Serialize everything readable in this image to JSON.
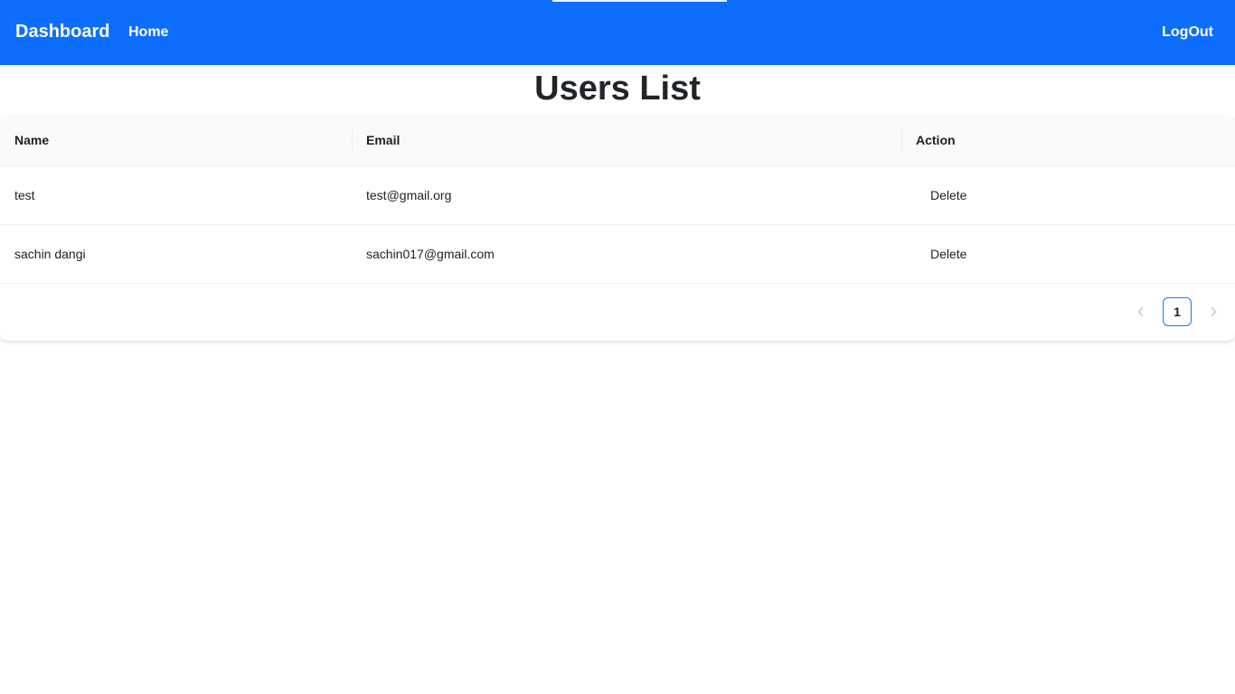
{
  "navbar": {
    "brand": "Dashboard",
    "home": "Home",
    "logout": "LogOut",
    "color": "#0d6efd"
  },
  "page": {
    "title": "Users List"
  },
  "table": {
    "columns": [
      "Name",
      "Email",
      "Action"
    ],
    "rows": [
      {
        "name": "test",
        "email": "test@gmail.org",
        "action": "Delete"
      },
      {
        "name": "sachin dangi",
        "email": "sachin017@gmail.com",
        "action": "Delete"
      }
    ]
  },
  "pagination": {
    "current_page": "1",
    "prev_icon": "chevron-left-icon",
    "next_icon": "chevron-right-icon"
  }
}
